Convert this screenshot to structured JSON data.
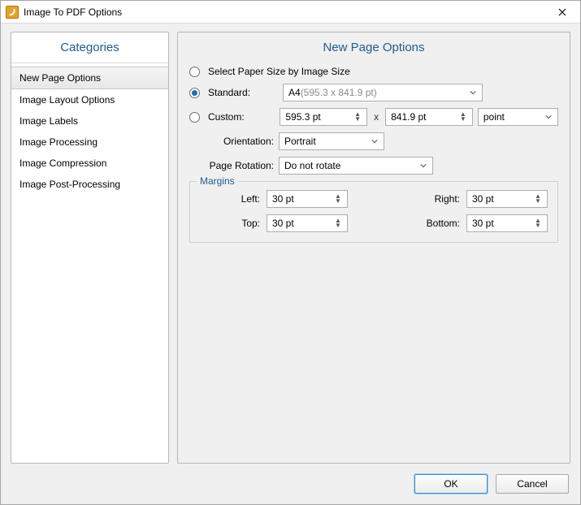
{
  "window": {
    "title": "Image To PDF Options"
  },
  "sidebar": {
    "header": "Categories",
    "items": [
      {
        "label": "New Page Options"
      },
      {
        "label": "Image Layout Options"
      },
      {
        "label": "Image Labels"
      },
      {
        "label": "Image Processing"
      },
      {
        "label": "Image Compression"
      },
      {
        "label": "Image Post-Processing"
      }
    ],
    "selected": 0
  },
  "main": {
    "header": "New Page Options",
    "radio_image_size": "Select Paper Size by Image Size",
    "radio_standard": "Standard:",
    "radio_custom": "Custom:",
    "standard_value_prefix": "A4",
    "standard_value_suffix": " (595.3 x 841.9 pt)",
    "custom_w": "595.3 pt",
    "custom_h": "841.9 pt",
    "custom_unit": "point",
    "times": "x",
    "orientation_label": "Orientation:",
    "orientation_value": "Portrait",
    "rotation_label": "Page Rotation:",
    "rotation_value": "Do not rotate",
    "margins": {
      "title": "Margins",
      "left_label": "Left:",
      "left_value": "30 pt",
      "right_label": "Right:",
      "right_value": "30 pt",
      "top_label": "Top:",
      "top_value": "30 pt",
      "bottom_label": "Bottom:",
      "bottom_value": "30 pt"
    }
  },
  "footer": {
    "ok": "OK",
    "cancel": "Cancel"
  }
}
